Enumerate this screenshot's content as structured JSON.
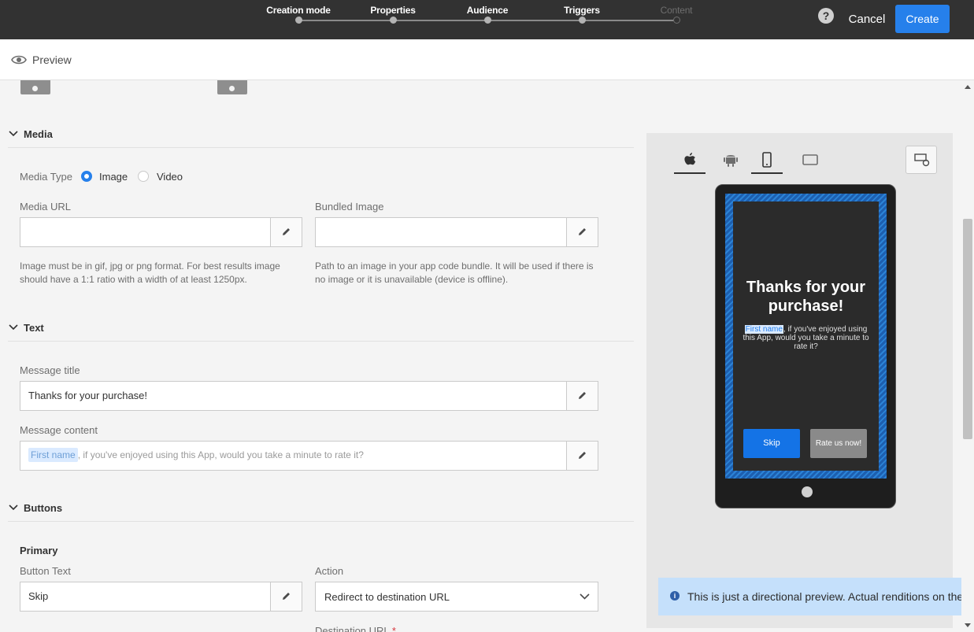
{
  "topbar": {
    "steps": [
      {
        "label": "Creation mode",
        "state": "done"
      },
      {
        "label": "Properties",
        "state": "done"
      },
      {
        "label": "Audience",
        "state": "done"
      },
      {
        "label": "Triggers",
        "state": "done"
      },
      {
        "label": "Content",
        "state": "inactive"
      }
    ],
    "help_label": "?",
    "cancel_label": "Cancel",
    "create_label": "Create"
  },
  "previewbar": {
    "label": "Preview"
  },
  "media": {
    "section_title": "Media",
    "media_type_label": "Media Type",
    "options": [
      {
        "label": "Image",
        "selected": true
      },
      {
        "label": "Video",
        "selected": false
      }
    ],
    "media_url_label": "Media URL",
    "media_url_value": "",
    "media_url_help": [
      "Image must be in gif, jpg or png format. For best results image",
      "should have a 1:1 ratio with a width of at least 1250px."
    ],
    "bundled_label": "Bundled Image",
    "bundled_value": "",
    "bundled_help": [
      "Path to an image in your app code bundle. It will be used if there is",
      "no image or it is unavailable (device is offline)."
    ]
  },
  "text": {
    "section_title": "Text",
    "title_label": "Message title",
    "title_value": "Thanks for your purchase!",
    "content_label": "Message content",
    "content_pill": "First name",
    "content_rest": ", if you've enjoyed using this App, would you take a minute to rate it?"
  },
  "buttons": {
    "section_title": "Buttons",
    "primary_label": "Primary",
    "button_text_label": "Button Text",
    "button_text_value": "Skip",
    "action_label": "Action",
    "action_value": "Redirect to destination URL",
    "destination_label": "Destination URL",
    "required_mark": "*"
  },
  "preview_panel": {
    "os_tabs": [
      "apple-icon",
      "android-icon",
      "phone-icon",
      "tablet-icon"
    ],
    "message_title": "Thanks for your purchase!",
    "message_pill": "First name",
    "message_rest": ", if you've enjoyed using this App, would you take a minute to rate it?",
    "btn_primary": "Skip",
    "btn_secondary": "Rate us now!"
  },
  "toast": {
    "text": "This is just a directional preview. Actual renditions on the de"
  },
  "colors": {
    "accent": "#2680eb",
    "topbar": "#323232",
    "toast_bg": "#c5e0fb"
  }
}
